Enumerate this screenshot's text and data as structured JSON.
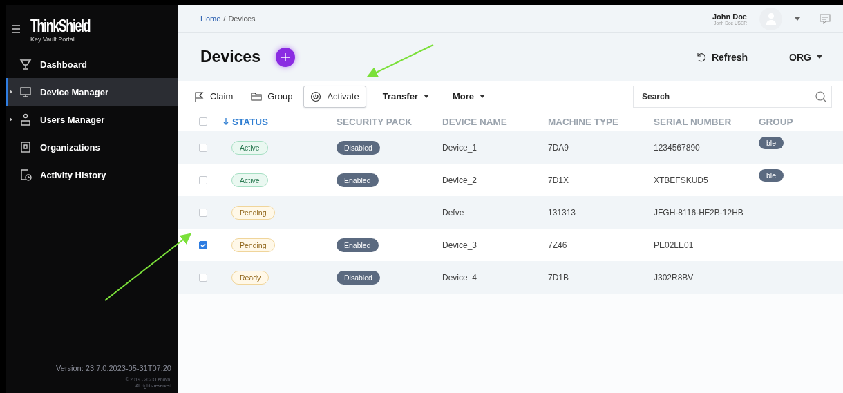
{
  "sidebar": {
    "logo": {
      "title": "ThinkShield",
      "subtitle": "Key Vault Portal"
    },
    "items": [
      {
        "label": "Dashboard",
        "selected": false,
        "expandable": false
      },
      {
        "label": "Device Manager",
        "selected": true,
        "expandable": true
      },
      {
        "label": "Users Manager",
        "selected": false,
        "expandable": true
      },
      {
        "label": "Organizations",
        "selected": false,
        "expandable": false
      },
      {
        "label": "Activity History",
        "selected": false,
        "expandable": false
      }
    ],
    "version": "Version: 23.7.0.2023-05-31T07:20",
    "copyright": [
      "© 2019 - 2023 Lenovo.",
      "All rights reserved"
    ]
  },
  "header": {
    "breadcrumb": [
      {
        "label": "Home",
        "link": true
      },
      {
        "label": "Devices",
        "link": false
      }
    ],
    "separator": "/",
    "user": {
      "name": "John Doe",
      "role": "Jonh Doe USER"
    }
  },
  "page": {
    "title": "Devices",
    "refresh": "Refresh",
    "org": "ORG"
  },
  "toolbar": {
    "actions": [
      {
        "label": "Claim",
        "kind": "button",
        "selected": false
      },
      {
        "label": "Group",
        "kind": "button",
        "selected": false
      },
      {
        "label": "Activate",
        "kind": "button",
        "selected": true
      },
      {
        "label": "Transfer",
        "kind": "dropdown",
        "selected": false
      },
      {
        "label": "More",
        "kind": "dropdown",
        "selected": false
      }
    ],
    "search": {
      "placeholder": "Search"
    }
  },
  "table": {
    "all_checked": false,
    "columns": [
      {
        "label": "STATUS",
        "sorted": true
      },
      {
        "label": "SECURITY PACK",
        "sorted": false
      },
      {
        "label": "DEVICE NAME",
        "sorted": false
      },
      {
        "label": "MACHINE TYPE",
        "sorted": false
      },
      {
        "label": "SERIAL NUMBER",
        "sorted": false
      },
      {
        "label": "GROUP",
        "sorted": false
      }
    ],
    "rows": [
      {
        "checked": false,
        "status": {
          "label": "Active",
          "kind": "active"
        },
        "security_pack": "Disabled",
        "device_name": "Device_1",
        "machine_type": "7DA9",
        "serial_number": "1234567890",
        "group": "ble"
      },
      {
        "checked": false,
        "status": {
          "label": "Active",
          "kind": "active"
        },
        "security_pack": "Enabled",
        "device_name": "Device_2",
        "machine_type": "7D1X",
        "serial_number": "XTBEFSKUD5",
        "group": "ble"
      },
      {
        "checked": false,
        "status": {
          "label": "Pending",
          "kind": "pending"
        },
        "device_name": "Defve",
        "machine_type": "131313",
        "serial_number": "JFGH-8116-HF2B-12HB"
      },
      {
        "checked": true,
        "status": {
          "label": "Pending",
          "kind": "pending"
        },
        "security_pack": "Enabled",
        "device_name": "Device_3",
        "machine_type": "7Z46",
        "serial_number": "PE02LE01"
      },
      {
        "checked": false,
        "status": {
          "label": "Ready",
          "kind": "ready"
        },
        "security_pack": "Disabled",
        "device_name": "Device_4",
        "machine_type": "7D1B",
        "serial_number": "J302R8BV"
      }
    ]
  }
}
